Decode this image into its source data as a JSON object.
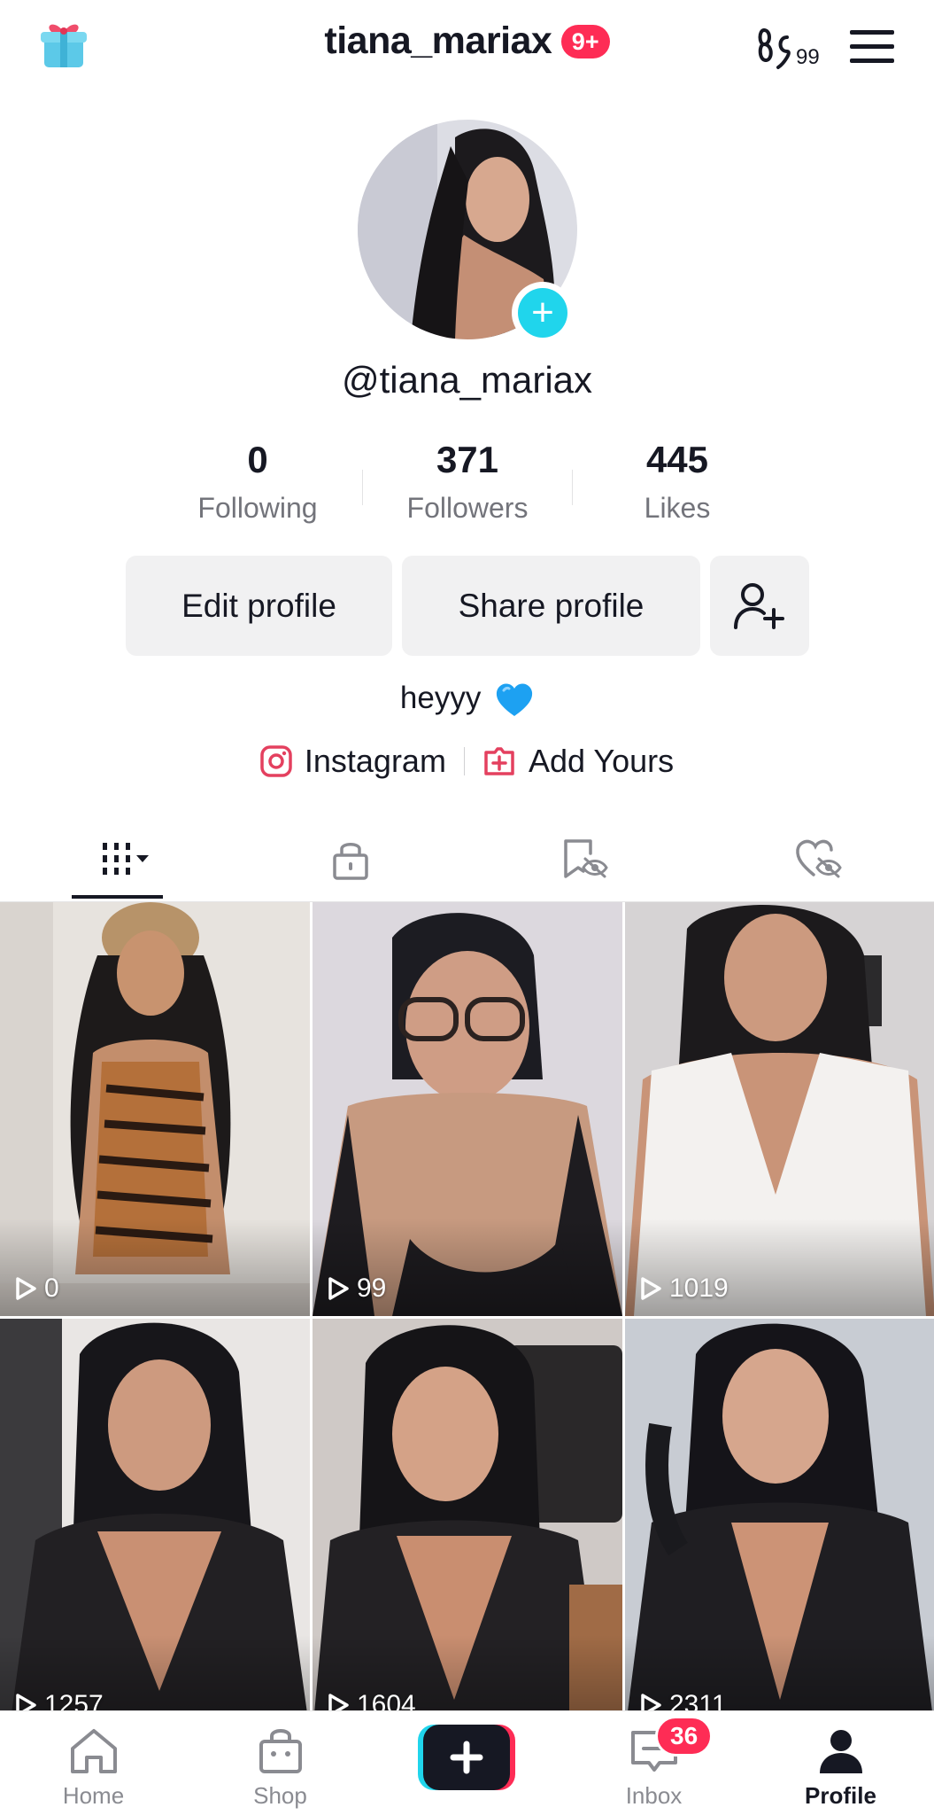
{
  "header": {
    "username": "tiana_mariax",
    "notification_badge": "9+",
    "monetize_count": "99"
  },
  "profile": {
    "handle": "@tiana_mariax",
    "stats": [
      {
        "value": "0",
        "label": "Following"
      },
      {
        "value": "371",
        "label": "Followers"
      },
      {
        "value": "445",
        "label": "Likes"
      }
    ],
    "buttons": {
      "edit": "Edit profile",
      "share": "Share profile"
    },
    "bio": "heyyy",
    "links": [
      {
        "label": "Instagram",
        "icon": "instagram-icon"
      },
      {
        "label": "Add Yours",
        "icon": "add-yours-icon"
      }
    ]
  },
  "tabs": [
    {
      "icon": "videos-grid-icon",
      "active": true
    },
    {
      "icon": "lock-icon",
      "active": false
    },
    {
      "icon": "bookmark-hidden-icon",
      "active": false
    },
    {
      "icon": "liked-hidden-icon",
      "active": false
    }
  ],
  "videos": [
    {
      "views": "0"
    },
    {
      "views": "99"
    },
    {
      "views": "1019"
    },
    {
      "views": "1257"
    },
    {
      "views": "1604"
    },
    {
      "views": "2311"
    }
  ],
  "bottom_nav": {
    "items": [
      {
        "label": "Home",
        "icon": "home-icon"
      },
      {
        "label": "Shop",
        "icon": "shop-icon"
      },
      {
        "label": "",
        "icon": "create-plus-icon"
      },
      {
        "label": "Inbox",
        "icon": "inbox-icon"
      },
      {
        "label": "Profile",
        "icon": "profile-icon"
      }
    ],
    "inbox_badge": "36"
  },
  "colors": {
    "accent_red": "#fe2c55",
    "accent_cyan": "#20d5ec",
    "text_primary": "#161823",
    "text_secondary": "#73747b",
    "button_bg": "#f1f1f2"
  }
}
